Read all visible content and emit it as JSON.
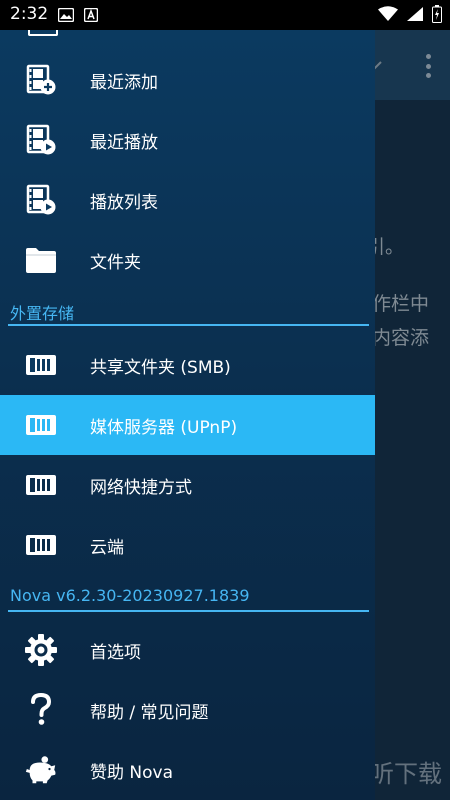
{
  "status_bar": {
    "time": "2:32"
  },
  "background": {
    "text_lines": [
      "引。",
      "作栏中",
      "内容添"
    ]
  },
  "drawer": {
    "items_top": [
      {
        "label": "最近添加",
        "icon": "film-add-icon"
      },
      {
        "label": "最近播放",
        "icon": "film-play-icon"
      },
      {
        "label": "播放列表",
        "icon": "film-playlist-icon"
      },
      {
        "label": "文件夹",
        "icon": "folder-icon"
      }
    ],
    "section_external": "外置存储",
    "items_storage": [
      {
        "label": "共享文件夹 (SMB)",
        "icon": "server-icon",
        "selected": false
      },
      {
        "label": "媒体服务器 (UPnP)",
        "icon": "server-icon",
        "selected": true
      },
      {
        "label": "网络快捷方式",
        "icon": "server-icon",
        "selected": false
      },
      {
        "label": "云端",
        "icon": "server-icon",
        "selected": false
      }
    ],
    "section_version": "Nova v6.2.30-20230927.1839",
    "items_bottom": [
      {
        "label": "首选项",
        "icon": "gear-icon"
      },
      {
        "label": "帮助 / 常见问题",
        "icon": "question-icon"
      },
      {
        "label": "赞助 Nova",
        "icon": "piggy-bank-icon"
      }
    ]
  },
  "watermark": {
    "text": "一听下载",
    "icon_glyph": "听"
  },
  "colors": {
    "accent": "#46b6f2",
    "selected": "#2bb8f5",
    "drawer": "#0b3a60"
  }
}
